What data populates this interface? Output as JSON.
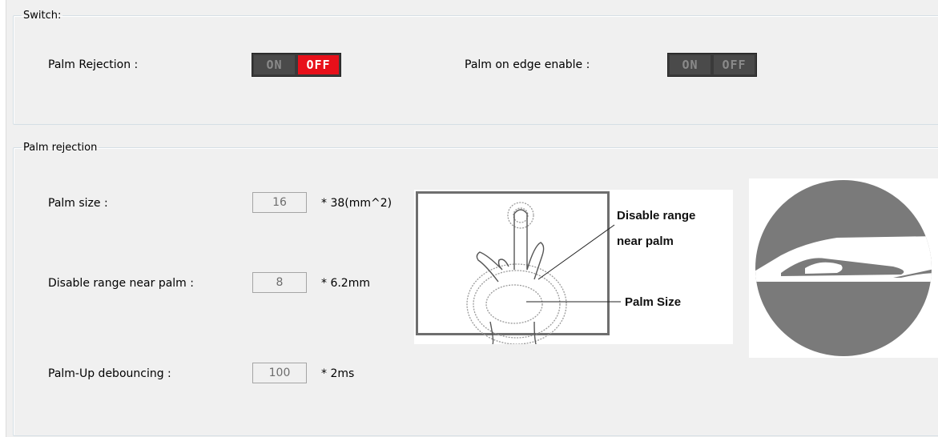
{
  "switch_group": {
    "legend": "Switch:",
    "palm_rejection_label": "Palm Rejection :",
    "palm_rejection_on": "ON",
    "palm_rejection_off": "OFF",
    "palm_edge_label": "Palm on edge enable :",
    "palm_edge_on": "ON",
    "palm_edge_off": "OFF"
  },
  "palm_group": {
    "legend": "Palm rejection",
    "palm_size_label": "Palm size :",
    "palm_size_value": "16",
    "palm_size_unit": "* 38(mm^2)",
    "disable_range_label": "Disable range near palm :",
    "disable_range_value": "8",
    "disable_range_unit": "* 6.2mm",
    "debounce_label": "Palm-Up debouncing :",
    "debounce_value": "100",
    "debounce_unit": "* 2ms"
  },
  "illustration": {
    "callout_disable_line1": "Disable range",
    "callout_disable_line2": "near palm",
    "callout_palm_size": "Palm Size"
  },
  "colors": {
    "toggle_off_active": "#e8101a",
    "toggle_bg": "#3a3a3a",
    "illustration_gray": "#7a7a7a"
  }
}
